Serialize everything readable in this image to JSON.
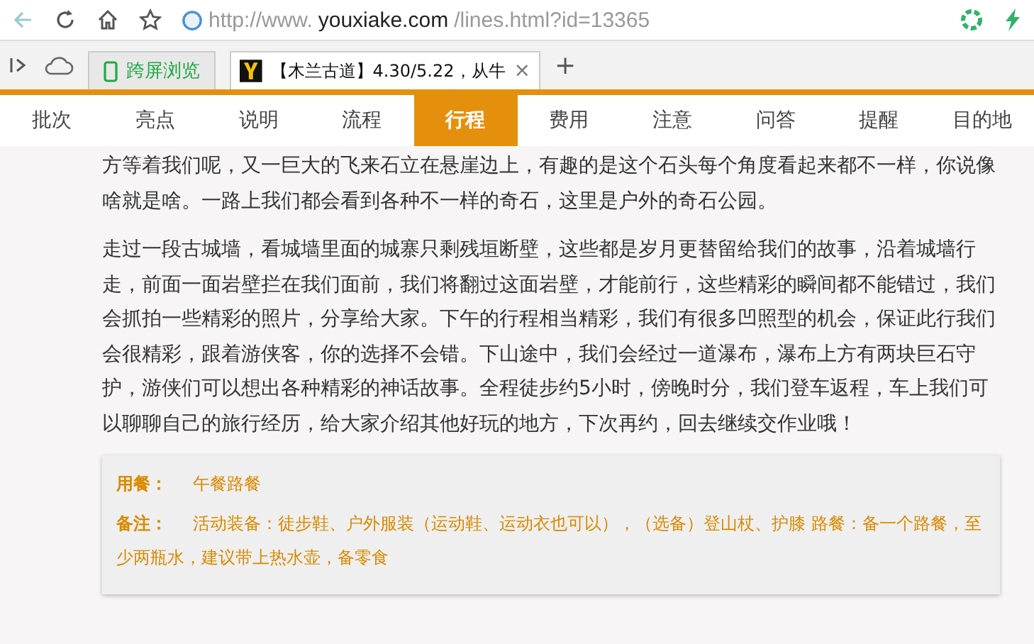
{
  "address_bar": {
    "url_prefix": "http://www.",
    "url_domain": "youxiake.com",
    "url_path": "/lines.html?id=13365"
  },
  "browser_tabs": [
    {
      "kind": "app",
      "label": "跨屏浏览",
      "selected": false
    },
    {
      "kind": "page",
      "label": "【木兰古道】4.30/5.22，从牛",
      "selected": true,
      "close": "×"
    }
  ],
  "new_tab": "+",
  "nav_tabs": [
    {
      "label": "批次",
      "selected": false
    },
    {
      "label": "亮点",
      "selected": false
    },
    {
      "label": "说明",
      "selected": false
    },
    {
      "label": "流程",
      "selected": false
    },
    {
      "label": "行程",
      "selected": true
    },
    {
      "label": "费用",
      "selected": false
    },
    {
      "label": "注意",
      "selected": false
    },
    {
      "label": "问答",
      "selected": false
    },
    {
      "label": "提醒",
      "selected": false
    },
    {
      "label": "目的地",
      "selected": false
    }
  ],
  "paragraphs": [
    "方等着我们呢，又一巨大的飞来石立在悬崖边上，有趣的是这个石头每个角度看起来都不一样，你说像啥就是啥。一路上我们都会看到各种不一样的奇石，这里是户外的奇石公园。",
    "走过一段古城墙，看城墙里面的城寨只剩残垣断壁，这些都是岁月更替留给我们的故事，沿着城墙行走，前面一面岩壁拦在我们面前，我们将翻过这面岩壁，才能前行，这些精彩的瞬间都不能错过，我们会抓拍一些精彩的照片，分享给大家。下午的行程相当精彩，我们有很多凹照型的机会，保证此行我们会很精彩，跟着游侠客，你的选择不会错。下山途中，我们会经过一道瀑布，瀑布上方有两块巨石守护，游侠们可以想出各种精彩的神话故事。全程徒步约5小时，傍晚时分，我们登车返程，车上我们可以聊聊自己的旅行经历，给大家介绍其他好玩的地方，下次再约，回去继续交作业哦！"
  ],
  "info": [
    {
      "label": "用餐：",
      "value": "午餐路餐"
    },
    {
      "label": "备注：",
      "value": "活动装备：徒步鞋、户外服装（运动鞋、运动衣也可以），（选备）登山杖、护膝 路餐：备一个路餐，至少两瓶水，建议带上热水壶，备零食"
    }
  ]
}
